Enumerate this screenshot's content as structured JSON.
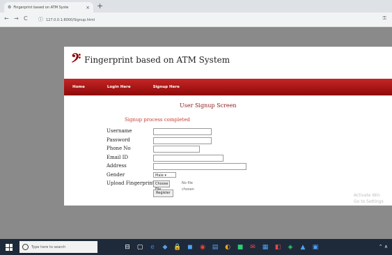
{
  "browser": {
    "tab_title": "Fingerprint based on ATM Syste",
    "tab_close": "×",
    "new_tab": "+",
    "url": "127.0.0.1:8000/Signup.html",
    "back": "←",
    "forward": "→",
    "reload": "C",
    "info": "ⓘ",
    "key": "⚿"
  },
  "site": {
    "logo": "𝄢",
    "title": "Fingerprint based on ATM System",
    "nav": [
      "Home",
      "Login Here",
      "Signup Here"
    ]
  },
  "signup": {
    "screen_title": "User Signup Screen",
    "message": "Signup process completed",
    "labels": {
      "username": "Username",
      "password": "Password",
      "phone": "Phone No",
      "email": "Email ID",
      "address": "Address",
      "gender": "Gender",
      "upload": "Upload Fingerprint"
    },
    "gender_value": "Male ▾",
    "choose_file": "Choose File",
    "no_file": "No file chosen",
    "register": "Register"
  },
  "os": {
    "watermark_line1": "Activate Win",
    "watermark_line2": "Go to Settings",
    "search_placeholder": "Type here to search",
    "taskbar_icons": [
      "⊟",
      "▢",
      "e",
      "◆",
      "🔒",
      "◼",
      "◉",
      "▤",
      "◐",
      "■",
      "✉",
      "▦",
      "◧",
      "◈",
      "▲",
      "▣"
    ],
    "tray": "⌃ ∧"
  },
  "colors": {
    "nav_red": "#b11717",
    "accent_red": "#8b1a1a",
    "message_red": "#c2403a"
  }
}
